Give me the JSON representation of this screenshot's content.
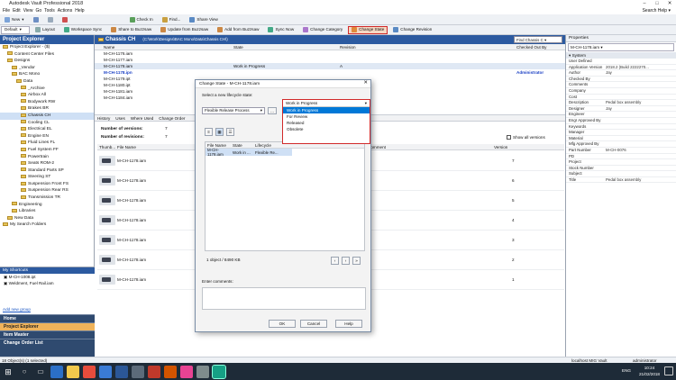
{
  "window": {
    "title": "Autodesk Vault Professional 2018",
    "search_label": "Search Help"
  },
  "menu": [
    "File",
    "Edit",
    "View",
    "Go",
    "Tools",
    "Actions",
    "Help"
  ],
  "toolbar1": {
    "new": "New",
    "checkin": "Check In",
    "find": "Find...",
    "share_view": "Share View"
  },
  "toolbar2": {
    "layout": "Default",
    "layout_btn": "Layout",
    "buttons": [
      "Workspace Sync",
      "Share to Buzzsaw",
      "Update from Buzzsaw",
      "Add from Buzzsaw",
      "Sync Now",
      "Change Category",
      "Change State",
      "Change Revision"
    ]
  },
  "explorer": {
    "title": "Project Explorer",
    "tree": [
      {
        "label": "Project Explorer - ($)",
        "indent": 0
      },
      {
        "label": "Content Center Files",
        "indent": 1
      },
      {
        "label": "Designs",
        "indent": 1
      },
      {
        "label": "_Vendor",
        "indent": 2
      },
      {
        "label": "BAC Mono",
        "indent": 2
      },
      {
        "label": "Data",
        "indent": 3
      },
      {
        "label": "_Archive",
        "indent": 4
      },
      {
        "label": "Airbox All",
        "indent": 4
      },
      {
        "label": "Bodywork RW",
        "indent": 4
      },
      {
        "label": "Brakes BR",
        "indent": 4
      },
      {
        "label": "Chassis CH",
        "indent": 4
      },
      {
        "label": "Cooling CL",
        "indent": 4
      },
      {
        "label": "Electrical EL",
        "indent": 4
      },
      {
        "label": "Engine EN",
        "indent": 4
      },
      {
        "label": "Fluid Lines FL",
        "indent": 4
      },
      {
        "label": "Fuel System FF",
        "indent": 4
      },
      {
        "label": "Powertrain",
        "indent": 4
      },
      {
        "label": "Seats ROM-2",
        "indent": 4
      },
      {
        "label": "Standard Parts SP",
        "indent": 4
      },
      {
        "label": "Steering ST",
        "indent": 4
      },
      {
        "label": "Suspension Front FS",
        "indent": 4
      },
      {
        "label": "Suspension Rear RS",
        "indent": 4
      },
      {
        "label": "Transmission TR",
        "indent": 4
      },
      {
        "label": "Engineering",
        "indent": 2
      },
      {
        "label": "Libraries",
        "indent": 2
      },
      {
        "label": "New Data",
        "indent": 1
      },
      {
        "label": "My Search Folders",
        "indent": 0
      }
    ]
  },
  "shortcuts": {
    "title": "My Shortcuts",
    "items": [
      "M-CH-1008.ipt",
      "Weldment, Fuel Rail.iam"
    ],
    "add_group": "Add new group"
  },
  "nav": [
    "Home",
    "Project Explorer",
    "Item Master",
    "Change Order List"
  ],
  "main": {
    "folder_title": "Chassis CH",
    "path": "(C:\\Work\\Designs\\BAC Mono\\Data\\Chassis CH\\)",
    "columns": [
      "Name",
      "State",
      "Revision",
      "Checked Out By"
    ],
    "files": [
      {
        "name": "M-CH-1176.iam",
        "state": "",
        "rev": "",
        "by": ""
      },
      {
        "name": "M-CH-1177.iam",
        "state": "",
        "rev": "",
        "by": ""
      },
      {
        "name": "M-CH-1178.iam",
        "state": "Work in Progress",
        "rev": "A",
        "by": ""
      },
      {
        "name": "M-CH-1178.ipn",
        "state": "",
        "rev": "",
        "by": "Administrator"
      },
      {
        "name": "M-CH-1179.ipt",
        "state": "",
        "rev": "",
        "by": ""
      },
      {
        "name": "M-CH-1180.ipt",
        "state": "",
        "rev": "",
        "by": ""
      },
      {
        "name": "M-CH-1181.iam",
        "state": "",
        "rev": "",
        "by": ""
      },
      {
        "name": "M-CH-1184.iam",
        "state": "",
        "rev": "",
        "by": ""
      }
    ],
    "tabs": [
      "History",
      "Uses",
      "Where Used",
      "Change Order"
    ],
    "versions_label": "Number of versions:",
    "versions_value": "7",
    "revisions_label": "Number of revisions:",
    "revisions_value": "7",
    "show_all": "Show all versions",
    "hist_columns": [
      "Thumb...",
      "File Name",
      "Comment",
      "Version"
    ],
    "history": [
      {
        "name": "M-CH-1178.iam",
        "version": "7"
      },
      {
        "name": "M-CH-1178.iam",
        "version": "6"
      },
      {
        "name": "M-CH-1178.iam",
        "version": "5"
      },
      {
        "name": "M-CH-1178.iam",
        "version": "4"
      },
      {
        "name": "M-CH-1178.iam",
        "version": "3"
      },
      {
        "name": "M-CH-1178.iam",
        "version": "2"
      },
      {
        "name": "M-CH-1178.iam",
        "version": "1"
      }
    ],
    "find_select": "Find Chassis C"
  },
  "dialog": {
    "title": "Change State - M-CH-1178.iam",
    "select_label": "Select a new lifecycle state:",
    "lifecycle": "Flexible Release Process",
    "state_value": "Work in Progress",
    "state_options": [
      "Work in Progress",
      "For Review",
      "Released",
      "Obsolete"
    ],
    "grid_cols": [
      "File Name",
      "State",
      "Lifecycle"
    ],
    "grid_row": {
      "name": "M-CH-1178.iam",
      "state": "Work in ...",
      "lifecycle": "Flexible Re..."
    },
    "summary": "1 object / 8490 KB",
    "comments_label": "Enter comments:",
    "ok": "OK",
    "cancel": "Cancel",
    "help": "Help"
  },
  "properties": {
    "title": "Properties",
    "file": "M-CH-1178.iam",
    "section": "System",
    "rows": [
      {
        "k": "User Defined",
        "v": ""
      },
      {
        "k": "Application Version",
        "v": "2018.2 (Build 2222270..."
      },
      {
        "k": "Author",
        "v": "Jay"
      },
      {
        "k": "Checked By",
        "v": ""
      },
      {
        "k": "Comments",
        "v": ""
      },
      {
        "k": "Company",
        "v": ""
      },
      {
        "k": "Cost",
        "v": ""
      },
      {
        "k": "Description",
        "v": "Pedal box assembly"
      },
      {
        "k": "Designer",
        "v": "Jay"
      },
      {
        "k": "Engineer",
        "v": ""
      },
      {
        "k": "Engr Approved By",
        "v": ""
      },
      {
        "k": "Keywords",
        "v": ""
      },
      {
        "k": "Manager",
        "v": ""
      },
      {
        "k": "Material",
        "v": ""
      },
      {
        "k": "Mfg Approved By",
        "v": ""
      },
      {
        "k": "Part Number",
        "v": "M-CH-0076"
      },
      {
        "k": "PD",
        "v": ""
      },
      {
        "k": "Project",
        "v": ""
      },
      {
        "k": "Stock Number",
        "v": ""
      },
      {
        "k": "Subject",
        "v": ""
      },
      {
        "k": "Title",
        "v": "Pedal box assembly"
      }
    ]
  },
  "status": {
    "left": "18 Object(s) (1 selected)",
    "right": "localhost MIG Vault",
    "user": "administrator"
  },
  "taskbar": {
    "time": "10:24",
    "date": "21/02/2018",
    "lang": "ENG"
  }
}
